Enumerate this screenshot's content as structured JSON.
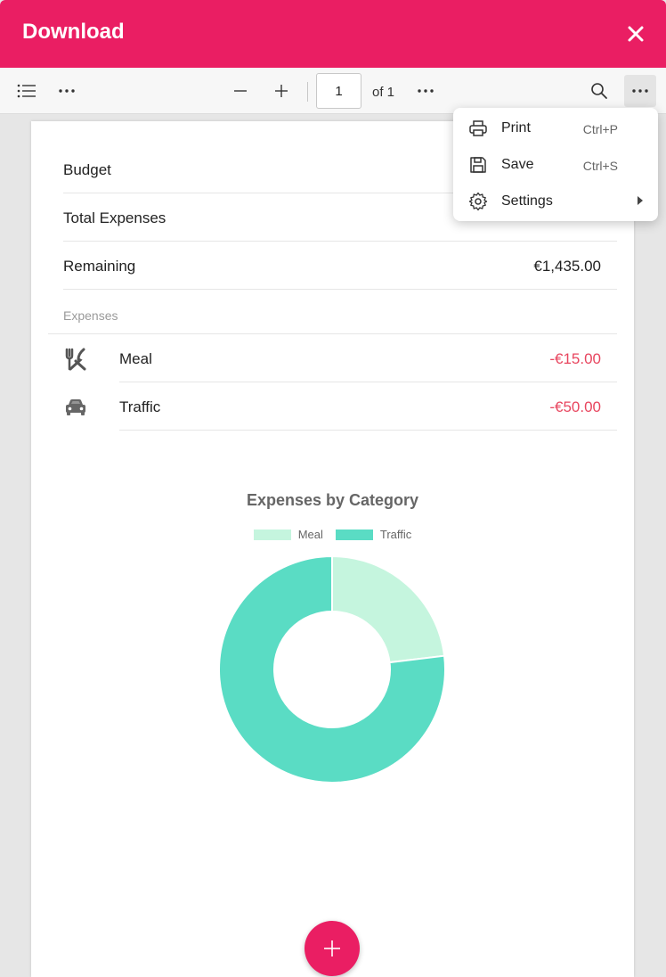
{
  "header": {
    "title": "Download"
  },
  "toolbar": {
    "page_value": "1",
    "page_of": "of 1"
  },
  "summary": {
    "rows": [
      {
        "label": "Budget",
        "value": ""
      },
      {
        "label": "Total Expenses",
        "value": ""
      },
      {
        "label": "Remaining",
        "value": "€1,435.00"
      }
    ]
  },
  "expenses": {
    "section_label": "Expenses",
    "items": [
      {
        "label": "Meal",
        "amount": "-€15.00",
        "icon": "fork-knife-icon"
      },
      {
        "label": "Traffic",
        "amount": "-€50.00",
        "icon": "car-icon"
      }
    ]
  },
  "chart_data": {
    "type": "pie",
    "title": "Expenses by Category",
    "categories": [
      "Meal",
      "Traffic"
    ],
    "values": [
      15,
      50
    ],
    "colors": [
      "#c5f5de",
      "#5adcc4"
    ],
    "legend_position": "top"
  },
  "menu": {
    "items": [
      {
        "label": "Print",
        "shortcut": "Ctrl+P",
        "icon": "printer-icon"
      },
      {
        "label": "Save",
        "shortcut": "Ctrl+S",
        "icon": "save-icon"
      },
      {
        "label": "Settings",
        "shortcut": "",
        "icon": "gear-icon"
      }
    ]
  },
  "colors": {
    "accent": "#ea1e63",
    "negative": "#e8465f"
  }
}
